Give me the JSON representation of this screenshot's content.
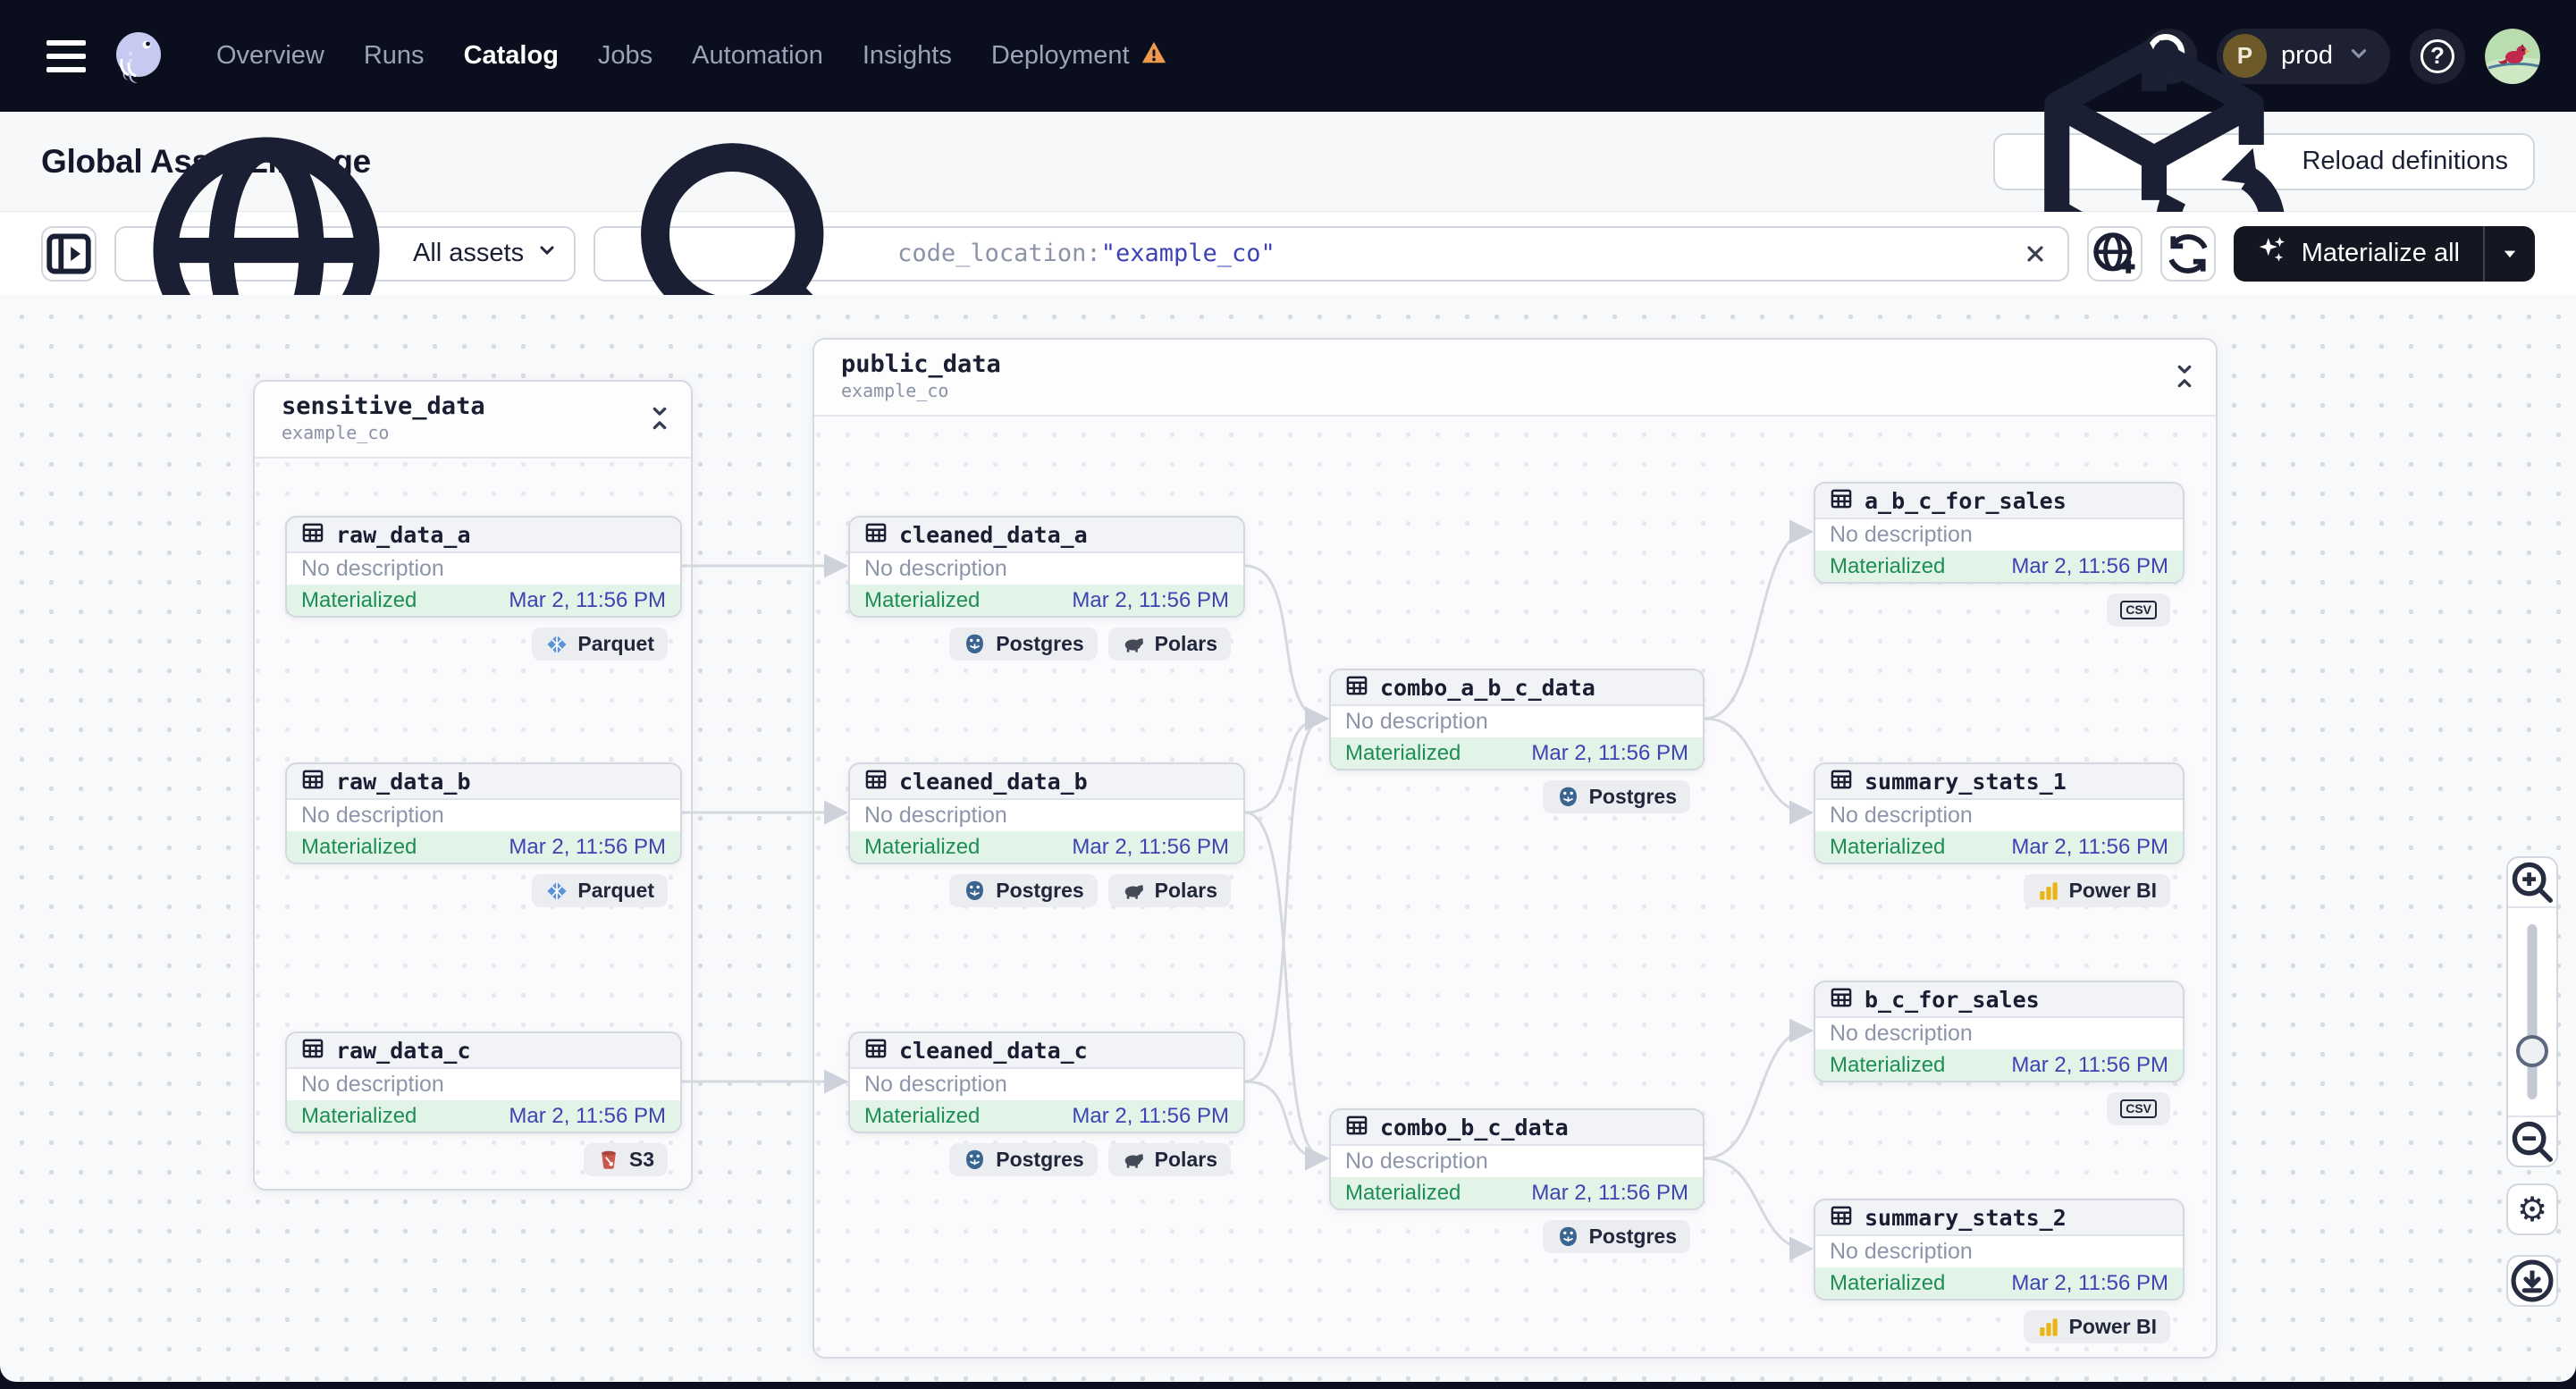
{
  "nav": {
    "items": [
      {
        "label": "Overview",
        "active": false,
        "warning": false
      },
      {
        "label": "Runs",
        "active": false,
        "warning": false
      },
      {
        "label": "Catalog",
        "active": true,
        "warning": false
      },
      {
        "label": "Jobs",
        "active": false,
        "warning": false
      },
      {
        "label": "Automation",
        "active": false,
        "warning": false
      },
      {
        "label": "Insights",
        "active": false,
        "warning": false
      },
      {
        "label": "Deployment",
        "active": false,
        "warning": true
      }
    ],
    "deployment_switcher": {
      "initial": "P",
      "label": "prod"
    }
  },
  "header": {
    "title": "Global Asset Lineage",
    "reload_button": "Reload definitions"
  },
  "toolbar": {
    "scope_label": "All assets",
    "search_token": "code_location:",
    "search_value": "\"example_co\"",
    "materialize_label": "Materialize all"
  },
  "graph": {
    "groups": [
      {
        "name": "sensitive_data",
        "location": "example_co"
      },
      {
        "name": "public_data",
        "location": "example_co"
      }
    ],
    "nodes": [
      {
        "id": "raw_data_a",
        "name": "raw_data_a",
        "group": "sensitive_data",
        "description": "No description",
        "status": "Materialized",
        "timestamp": "Mar 2, 11:56 PM",
        "tags": [
          {
            "icon": "parquet-icon",
            "label": "Parquet"
          }
        ]
      },
      {
        "id": "raw_data_b",
        "name": "raw_data_b",
        "group": "sensitive_data",
        "description": "No description",
        "status": "Materialized",
        "timestamp": "Mar 2, 11:56 PM",
        "tags": [
          {
            "icon": "parquet-icon",
            "label": "Parquet"
          }
        ]
      },
      {
        "id": "raw_data_c",
        "name": "raw_data_c",
        "group": "sensitive_data",
        "description": "No description",
        "status": "Materialized",
        "timestamp": "Mar 2, 11:56 PM",
        "tags": [
          {
            "icon": "s3-icon",
            "label": "S3"
          }
        ]
      },
      {
        "id": "cleaned_data_a",
        "name": "cleaned_data_a",
        "group": "public_data",
        "description": "No description",
        "status": "Materialized",
        "timestamp": "Mar 2, 11:56 PM",
        "tags": [
          {
            "icon": "postgres-icon",
            "label": "Postgres"
          },
          {
            "icon": "polars-icon",
            "label": "Polars"
          }
        ]
      },
      {
        "id": "cleaned_data_b",
        "name": "cleaned_data_b",
        "group": "public_data",
        "description": "No description",
        "status": "Materialized",
        "timestamp": "Mar 2, 11:56 PM",
        "tags": [
          {
            "icon": "postgres-icon",
            "label": "Postgres"
          },
          {
            "icon": "polars-icon",
            "label": "Polars"
          }
        ]
      },
      {
        "id": "cleaned_data_c",
        "name": "cleaned_data_c",
        "group": "public_data",
        "description": "No description",
        "status": "Materialized",
        "timestamp": "Mar 2, 11:56 PM",
        "tags": [
          {
            "icon": "postgres-icon",
            "label": "Postgres"
          },
          {
            "icon": "polars-icon",
            "label": "Polars"
          }
        ]
      },
      {
        "id": "combo_a_b_c_data",
        "name": "combo_a_b_c_data",
        "group": "public_data",
        "description": "No description",
        "status": "Materialized",
        "timestamp": "Mar 2, 11:56 PM",
        "tags": [
          {
            "icon": "postgres-icon",
            "label": "Postgres"
          }
        ]
      },
      {
        "id": "combo_b_c_data",
        "name": "combo_b_c_data",
        "group": "public_data",
        "description": "No description",
        "status": "Materialized",
        "timestamp": "Mar 2, 11:56 PM",
        "tags": [
          {
            "icon": "postgres-icon",
            "label": "Postgres"
          }
        ]
      },
      {
        "id": "a_b_c_for_sales",
        "name": "a_b_c_for_sales",
        "group": "public_data",
        "description": "No description",
        "status": "Materialized",
        "timestamp": "Mar 2, 11:56 PM",
        "tags": [
          {
            "icon": "csv-icon",
            "label": ""
          }
        ]
      },
      {
        "id": "summary_stats_1",
        "name": "summary_stats_1",
        "group": "public_data",
        "description": "No description",
        "status": "Materialized",
        "timestamp": "Mar 2, 11:56 PM",
        "tags": [
          {
            "icon": "powerbi-icon",
            "label": "Power BI"
          }
        ]
      },
      {
        "id": "b_c_for_sales",
        "name": "b_c_for_sales",
        "group": "public_data",
        "description": "No description",
        "status": "Materialized",
        "timestamp": "Mar 2, 11:56 PM",
        "tags": [
          {
            "icon": "csv-icon",
            "label": ""
          }
        ]
      },
      {
        "id": "summary_stats_2",
        "name": "summary_stats_2",
        "group": "public_data",
        "description": "No description",
        "status": "Materialized",
        "timestamp": "Mar 2, 11:56 PM",
        "tags": [
          {
            "icon": "powerbi-icon",
            "label": "Power BI"
          }
        ]
      }
    ],
    "edges": [
      [
        "raw_data_a",
        "cleaned_data_a"
      ],
      [
        "raw_data_b",
        "cleaned_data_b"
      ],
      [
        "raw_data_c",
        "cleaned_data_c"
      ],
      [
        "cleaned_data_a",
        "combo_a_b_c_data"
      ],
      [
        "cleaned_data_b",
        "combo_a_b_c_data"
      ],
      [
        "cleaned_data_c",
        "combo_a_b_c_data"
      ],
      [
        "cleaned_data_b",
        "combo_b_c_data"
      ],
      [
        "cleaned_data_c",
        "combo_b_c_data"
      ],
      [
        "combo_a_b_c_data",
        "a_b_c_for_sales"
      ],
      [
        "combo_a_b_c_data",
        "summary_stats_1"
      ],
      [
        "combo_b_c_data",
        "b_c_for_sales"
      ],
      [
        "combo_b_c_data",
        "summary_stats_2"
      ]
    ]
  },
  "colors": {
    "status_green": "#1e8e54",
    "timestamp_indigo": "#3d43b3",
    "warning_orange": "#f0994a",
    "materialize_bg": "#141722",
    "footer_green_bg": "#e2f4e8",
    "edge_gray": "#d4d8df"
  }
}
